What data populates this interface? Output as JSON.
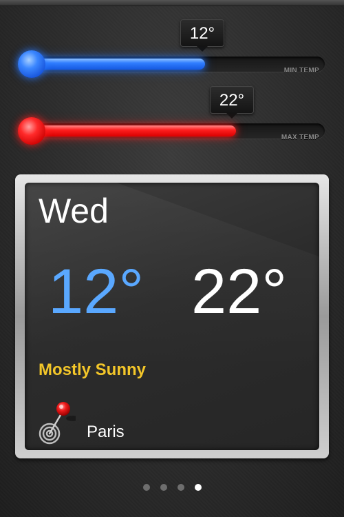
{
  "sliders": {
    "min": {
      "value_label": "12°",
      "track_label": "MIN TEMP",
      "fill_fraction": 0.61,
      "color": "#2f7dff"
    },
    "max": {
      "value_label": "22°",
      "track_label": "MAX TEMP",
      "fill_fraction": 0.71,
      "color": "#ff1f1f"
    }
  },
  "card": {
    "day": "Wed",
    "low": "12°",
    "high": "22°",
    "condition": "Mostly Sunny",
    "city": "Paris",
    "low_color": "#5aa8ff",
    "condition_color": "#f3c629",
    "pin_icon": "map-pin-icon"
  },
  "pager": {
    "count": 4,
    "active": 3
  }
}
